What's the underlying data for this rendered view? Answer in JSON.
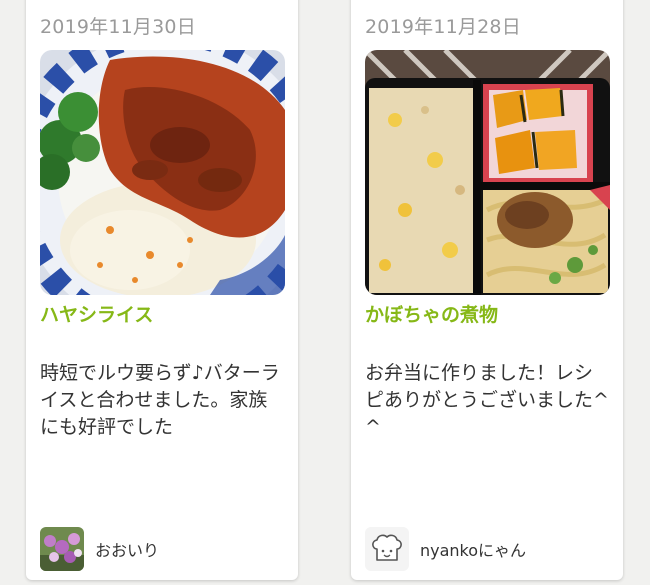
{
  "cards": [
    {
      "date": "2019年11月30日",
      "title": "ハヤシライス",
      "description": "時短でルウ要らず♪バターライスと合わせました。家族にも好評でした",
      "author": "おおいり",
      "avatar": "flower-photo-avatar"
    },
    {
      "date": "2019年11月28日",
      "title": "かぼちゃの煮物",
      "description": "お弁当に作りました！レシピありがとうございました^ ^",
      "author": "nyankoにゃん",
      "avatar": "chef-hat-icon"
    }
  ]
}
